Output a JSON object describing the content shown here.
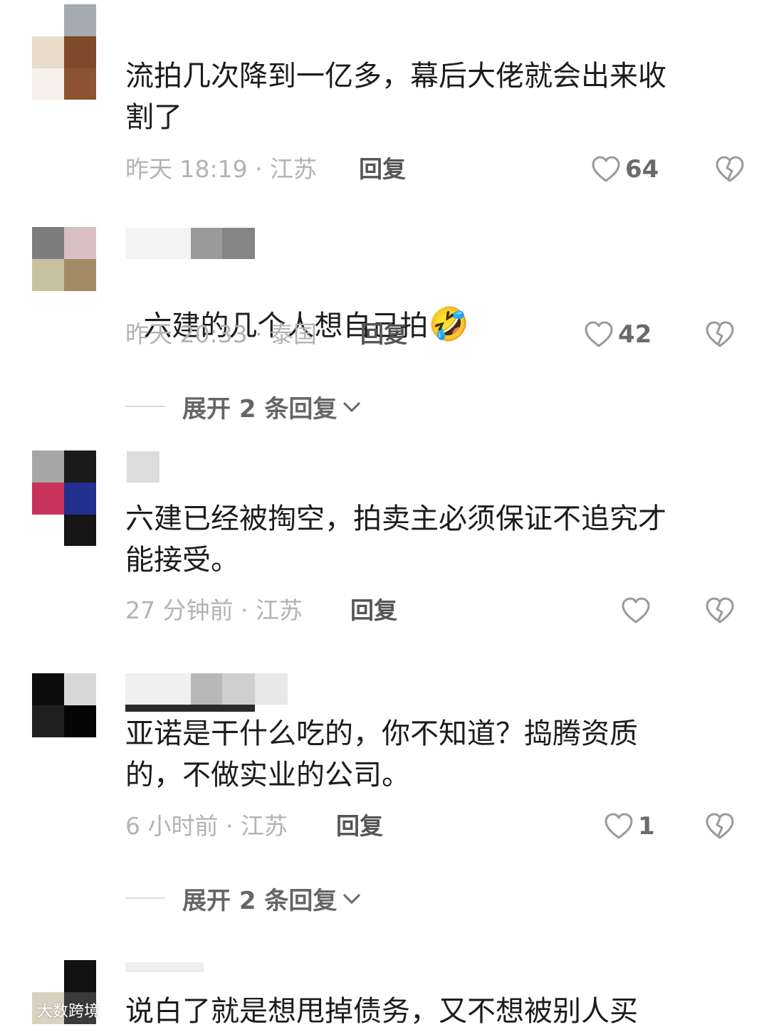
{
  "comments": [
    {
      "text": "流拍几次降到一亿多，幕后大佬就会出来收\n割了",
      "time_location": "昨天 18:19 · 江苏",
      "reply_label": "回复",
      "like_count": "64"
    },
    {
      "text": "六建的几个人想自己拍",
      "emoji": "🤣",
      "time_location": "昨天 20:33 · 泰国",
      "reply_label": "回复",
      "like_count": "42",
      "expand_label": "展开 2 条回复"
    },
    {
      "text": "六建已经被掏空，拍卖主必须保证不追究才\n能接受。",
      "time_location": "27 分钟前 · 江苏",
      "reply_label": "回复",
      "like_count": ""
    },
    {
      "text": "亚诺是干什么吃的，你不知道？捣腾资质\n的，不做实业的公司。",
      "time_location": "6 小时前 · 江苏",
      "reply_label": "回复",
      "like_count": "1",
      "expand_label": "展开 2 条回复"
    },
    {
      "text": "说白了就是想甩掉债务，又不想被别人买"
    }
  ],
  "watermark": "大数跨境",
  "icons": {
    "like": "heart-outline-icon",
    "dislike": "broken-heart-icon",
    "expand": "chevron-down-icon",
    "watermark": "weibo-logo-icon"
  },
  "colors": {
    "meta_text": "#b3b3b3",
    "reply_text": "#555555",
    "icon": "#9a9a9a"
  }
}
